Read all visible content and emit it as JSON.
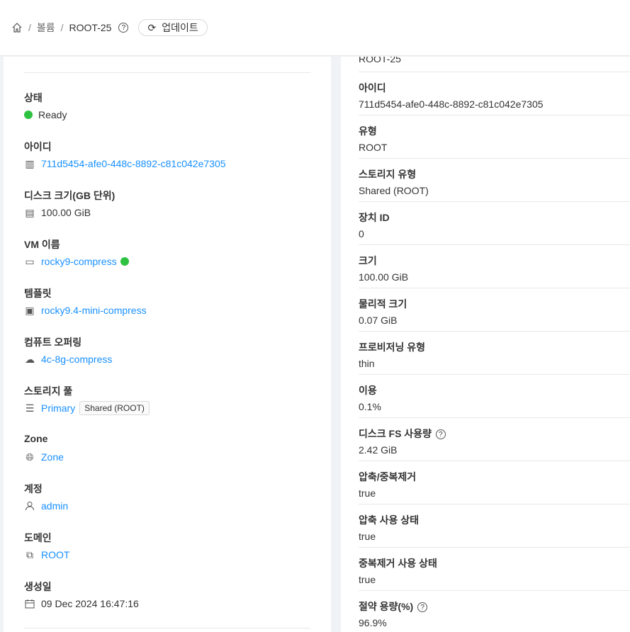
{
  "breadcrumb": {
    "home_icon": "home-icon",
    "section": "볼륨",
    "current": "ROOT-25",
    "refresh_label": "업데이트"
  },
  "left": {
    "state": {
      "label": "상태",
      "value": "Ready",
      "color": "#2fc140"
    },
    "id": {
      "label": "아이디",
      "value": "711d5454-afe0-448c-8892-c81c042e7305"
    },
    "disk_size": {
      "label": "디스크 크기(GB 단위)",
      "value": "100.00 GiB"
    },
    "vm": {
      "label": "VM 이름",
      "value": "rocky9-compress"
    },
    "template": {
      "label": "템플릿",
      "value": "rocky9.4-mini-compress"
    },
    "offering": {
      "label": "컴퓨트 오퍼링",
      "value": "4c-8g-compress"
    },
    "pool": {
      "label": "스토리지 풀",
      "value": "Primary",
      "tag": "Shared (ROOT)"
    },
    "zone": {
      "label": "Zone",
      "value": "Zone"
    },
    "account": {
      "label": "계정",
      "value": "admin"
    },
    "domain": {
      "label": "도메인",
      "value": "ROOT"
    },
    "created": {
      "label": "생성일",
      "value": "09 Dec 2024 16:47:16"
    }
  },
  "right": {
    "top_value": "ROOT-25",
    "rows": [
      {
        "label": "아이디",
        "value": "711d5454-afe0-448c-8892-c81c042e7305"
      },
      {
        "label": "유형",
        "value": "ROOT"
      },
      {
        "label": "스토리지 유형",
        "value": "Shared (ROOT)"
      },
      {
        "label": "장치 ID",
        "value": "0"
      },
      {
        "label": "크기",
        "value": "100.00 GiB"
      },
      {
        "label": "물리적 크기",
        "value": "0.07 GiB"
      },
      {
        "label": "프로비저닝 유형",
        "value": "thin"
      },
      {
        "label": "이용",
        "value": "0.1%"
      },
      {
        "label": "디스크 FS 사용량",
        "value": "2.42 GiB"
      },
      {
        "label": "압축/중복제거",
        "value": "true"
      },
      {
        "label": "압축 사용 상태",
        "value": "true"
      },
      {
        "label": "중복제거 사용 상태",
        "value": "true"
      },
      {
        "label": "절약 용량(%)",
        "value": "96.9%"
      }
    ]
  }
}
